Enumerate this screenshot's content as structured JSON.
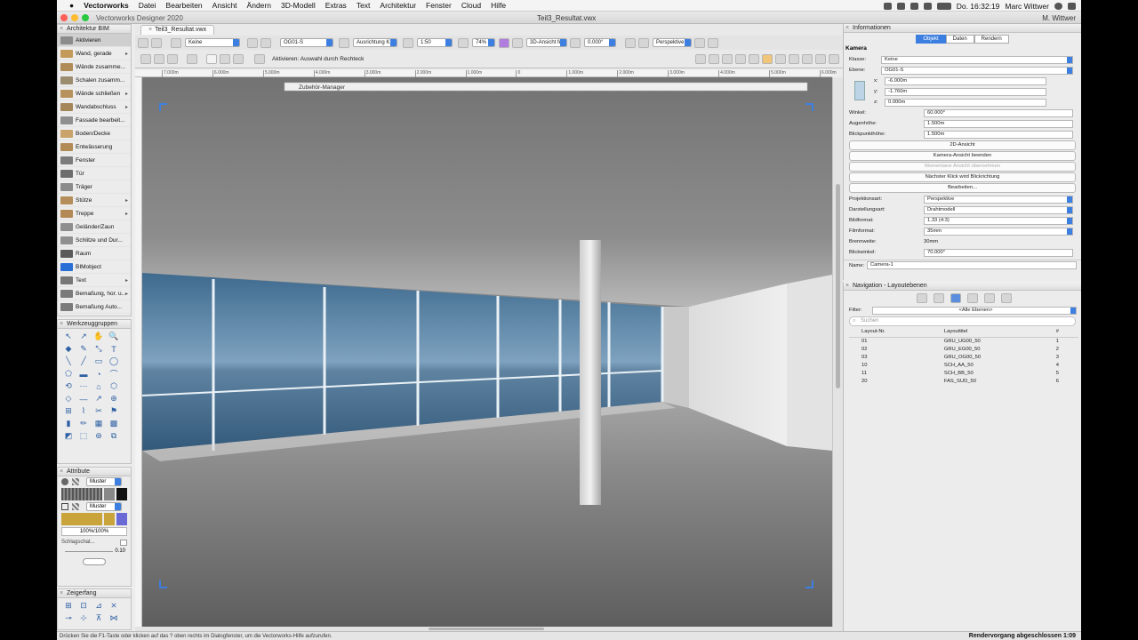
{
  "menubar": {
    "app": "Vectorworks",
    "items": [
      "Datei",
      "Bearbeiten",
      "Ansicht",
      "Ändern",
      "3D-Modell",
      "Extras",
      "Text",
      "Architektur",
      "Fenster",
      "Cloud",
      "Hilfe"
    ],
    "clock": "Do. 16:32:19",
    "user": "Marc Wittwer"
  },
  "window": {
    "app_title": "Vectorworks Designer 2020",
    "doc_title": "Teil3_Resultat.vwx",
    "tab_label": "Teil3_Resultat.vwx",
    "user_badge": "M. Wittwer"
  },
  "bim_palette": {
    "title": "Architektur BIM",
    "items": [
      {
        "label": "Aktivieren",
        "sel": true,
        "color": "#8c8c8c",
        "arrow": false
      },
      {
        "label": "Wand, gerade",
        "color": "#c39a5a",
        "arrow": true
      },
      {
        "label": "Wände zusamme...",
        "color": "#b08c58",
        "arrow": false
      },
      {
        "label": "Schalen zusamm...",
        "color": "#9c8c70",
        "arrow": false
      },
      {
        "label": "Wände schließen",
        "color": "#b7925c",
        "arrow": true
      },
      {
        "label": "Wandabschluss",
        "color": "#a58659",
        "arrow": true
      },
      {
        "label": "Fassade bearbeit...",
        "color": "#8f8f8f",
        "arrow": false
      },
      {
        "label": "Boden/Decke",
        "color": "#c9a36a",
        "arrow": false
      },
      {
        "label": "Entwässerung",
        "color": "#b28a55",
        "arrow": false
      },
      {
        "label": "Fenster",
        "color": "#7c7c7c",
        "arrow": false
      },
      {
        "label": "Tür",
        "color": "#6d6d6d",
        "arrow": false
      },
      {
        "label": "Träger",
        "color": "#8b8b8b",
        "arrow": false
      },
      {
        "label": "Stütze",
        "color": "#b58d5b",
        "arrow": true
      },
      {
        "label": "Treppe",
        "color": "#b38a56",
        "arrow": true
      },
      {
        "label": "Geländer/Zaun",
        "color": "#8e8e8e",
        "arrow": false
      },
      {
        "label": "Schlitze und Dur...",
        "color": "#909090",
        "arrow": false
      },
      {
        "label": "Raum",
        "color": "#5a5a5a",
        "arrow": false
      },
      {
        "label": "BIMobject",
        "color": "#2a6fd6",
        "arrow": false
      },
      {
        "label": "Text",
        "color": "#777777",
        "arrow": true
      },
      {
        "label": "Bemaßung, hor. u...",
        "color": "#7a7a7a",
        "arrow": true
      },
      {
        "label": "Bemaßung Auto...",
        "color": "#7a7a7a",
        "arrow": false
      }
    ]
  },
  "toolsets": {
    "title": "Werkzeuggruppen"
  },
  "attributes": {
    "title": "Attribute",
    "fill_style": "Muster",
    "pen_style": "Muster",
    "opacity": "100%/100%",
    "shadow_label": "Schlagschat...",
    "line_value": "0.10"
  },
  "snapping": {
    "title": "Zeigerfang"
  },
  "view_bar": {
    "class_value": "Keine",
    "layer_value": "OG01-S",
    "align_value": "Ausrichtung K...",
    "scale_value": "1:50",
    "zoom_value": "74%",
    "view_value": "3D-Ansicht fe...",
    "angle_value": "0.000°",
    "render_value": "Perspektive fe...",
    "mode_hint": "Aktivieren: Auswahl durch Rechteck"
  },
  "ruler": {
    "ticks": [
      "7.000m",
      "6.000m",
      "5.000m",
      "4.000m",
      "3.000m",
      "2.000m",
      "1.000m",
      "0",
      "1.000m",
      "2.000m",
      "3.000m",
      "4.000m",
      "5.000m",
      "6.000m"
    ]
  },
  "accessory_manager": {
    "title": "Zubehör-Manager"
  },
  "info_palette": {
    "title": "Informationen",
    "tabs": [
      "Objekt",
      "Daten",
      "Rendern"
    ],
    "active_tab": "Objekt",
    "object_type": "Kamera",
    "fields": {
      "klasse": {
        "label": "Klasse:",
        "value": "Keine"
      },
      "ebene": {
        "label": "Ebene:",
        "value": "OG01-S"
      },
      "x": {
        "label": "x:",
        "value": "-6.000m"
      },
      "y": {
        "label": "y:",
        "value": "-1.760m"
      },
      "z": {
        "label": "z:",
        "value": "0.000m"
      },
      "winkel": {
        "label": "Winkel:",
        "value": "60.000°"
      },
      "augenhoehe": {
        "label": "Augenhöhe:",
        "value": "1.500m"
      },
      "blickpunkt": {
        "label": "Blickpunkthöhe:",
        "value": "1.500m"
      }
    },
    "buttons": [
      "2D-Ansicht",
      "Kamera-Ansicht beenden",
      "Momentane Ansicht übernehmen",
      "Nächster Klick wird Blickrichtung",
      "Bearbeiten..."
    ],
    "fields2": {
      "projektion": {
        "label": "Projektionsart:",
        "value": "Perspektive"
      },
      "darstellung": {
        "label": "Darstellungsart:",
        "value": "Drahtmodell"
      },
      "bildformat": {
        "label": "Bildformat:",
        "value": "1.33 (4:3)"
      },
      "filmformat": {
        "label": "Filmformat:",
        "value": "35mm"
      },
      "brennweite": {
        "label": "Brennweite:",
        "value": "30mm"
      },
      "blickwinkel": {
        "label": "Blickwinkel:",
        "value": "70.000°"
      }
    },
    "name": {
      "label": "Name:",
      "value": "Camera-1"
    }
  },
  "nav_palette": {
    "title": "Navigation - Layoutebenen",
    "filter_label": "Filter:",
    "filter_value": "<Alle Ebenen>",
    "search_placeholder": "Suchen",
    "columns": [
      "Layout-Nr.",
      "Layouttitel",
      "#"
    ],
    "rows": [
      [
        "01",
        "GRU_UG00_50",
        "1"
      ],
      [
        "02",
        "GRU_EG00_50",
        "2"
      ],
      [
        "03",
        "GRU_OG00_50",
        "3"
      ],
      [
        "10",
        "SCH_AA_50",
        "4"
      ],
      [
        "11",
        "SCH_BB_50",
        "5"
      ],
      [
        "20",
        "FAS_SUD_50",
        "6"
      ]
    ]
  },
  "status": {
    "hint": "Drücken Sie die F1-Taste oder klicken auf das ? oben rechts im Dialogfenster, um die Vectorworks-Hilfe aufzurufen.",
    "render_status": "Rendervorgang abgeschlossen 1:09"
  },
  "colors": {
    "accent": "#3d7fe0"
  }
}
